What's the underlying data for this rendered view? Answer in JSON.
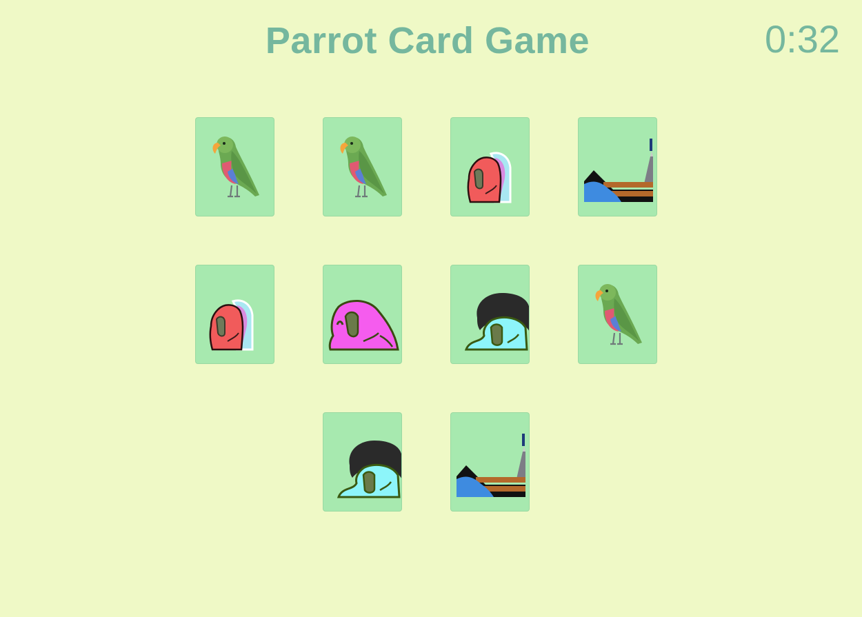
{
  "game": {
    "title": "Parrot Card Game",
    "timer": "0:32"
  },
  "colors": {
    "background": "#EFF9C6",
    "accent": "#75B79E",
    "card_face": "#A7E9AF"
  },
  "cards": [
    {
      "parrot": "green-parrot-icon"
    },
    {
      "parrot": "green-parrot-icon"
    },
    {
      "parrot": "red-party-parrot-icon"
    },
    {
      "parrot": "ship-parrot-icon"
    },
    {
      "parrot": "red-party-parrot-icon"
    },
    {
      "parrot": "magenta-party-parrot-icon"
    },
    {
      "parrot": "cyan-afro-parrot-icon"
    },
    {
      "parrot": "green-parrot-icon"
    },
    {
      "parrot": "cyan-afro-parrot-icon"
    },
    {
      "parrot": "ship-parrot-icon"
    }
  ]
}
